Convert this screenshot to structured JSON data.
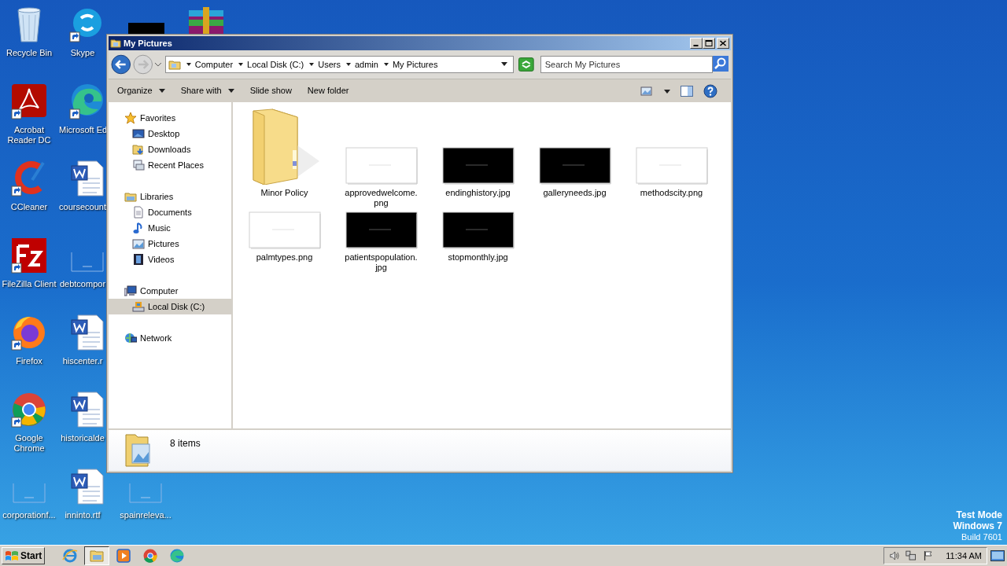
{
  "desktop": {
    "rows": [
      [
        {
          "label": "Recycle Bin",
          "kind": "recycle",
          "shortcut": false
        },
        {
          "label": "Skype",
          "kind": "skype",
          "shortcut": true
        }
      ],
      [
        {
          "label": "Acrobat Reader DC",
          "kind": "acrobat",
          "shortcut": true
        },
        {
          "label": "Microsoft Ed",
          "kind": "edge",
          "shortcut": true
        }
      ],
      [
        {
          "label": "CCleaner",
          "kind": "ccleaner",
          "shortcut": true
        },
        {
          "label": "coursecount",
          "kind": "word",
          "shortcut": false
        }
      ],
      [
        {
          "label": "FileZilla Client",
          "kind": "filezilla",
          "shortcut": true
        },
        {
          "label": "debtcompor",
          "kind": "blank",
          "shortcut": false
        }
      ],
      [
        {
          "label": "Firefox",
          "kind": "firefox",
          "shortcut": true
        },
        {
          "label": "hiscenter.r",
          "kind": "word",
          "shortcut": false
        }
      ],
      [
        {
          "label": "Google Chrome",
          "kind": "chrome",
          "shortcut": true
        },
        {
          "label": "historicalde",
          "kind": "word",
          "shortcut": false
        }
      ],
      [
        {
          "label": "corporationf...",
          "kind": "blank",
          "shortcut": false
        },
        {
          "label": "inninto.rtf",
          "kind": "word",
          "shortcut": false
        },
        {
          "label": "spainreleva...",
          "kind": "blank",
          "shortcut": false
        }
      ]
    ],
    "test_mode": [
      {
        "text": "Test Mode",
        "bold": true
      },
      {
        "text": "Windows 7",
        "bold": true
      },
      {
        "text": "Build 7601",
        "bold": false
      }
    ]
  },
  "window": {
    "title": "My Pictures",
    "back": {
      "disabled": false
    },
    "forward": {
      "disabled": true
    },
    "breadcrumb": [
      "Computer",
      "Local Disk (C:)",
      "Users",
      "admin",
      "My Pictures"
    ],
    "search": {
      "placeholder": "Search My Pictures"
    },
    "toolbar": [
      {
        "label": "Organize",
        "menu": true
      },
      {
        "label": "Share with",
        "menu": true
      },
      {
        "label": "Slide show",
        "menu": false
      },
      {
        "label": "New folder",
        "menu": false
      }
    ],
    "nav_pane": [
      {
        "label": "Favorites",
        "kind": "star",
        "selected": false,
        "children": [
          {
            "label": "Desktop",
            "kind": "desktop",
            "selected": false
          },
          {
            "label": "Downloads",
            "kind": "downloads",
            "selected": false
          },
          {
            "label": "Recent Places",
            "kind": "recent",
            "selected": false
          }
        ]
      },
      {
        "label": "Libraries",
        "kind": "library",
        "selected": false,
        "children": [
          {
            "label": "Documents",
            "kind": "documents",
            "selected": false
          },
          {
            "label": "Music",
            "kind": "music",
            "selected": false
          },
          {
            "label": "Pictures",
            "kind": "pictures",
            "selected": false
          },
          {
            "label": "Videos",
            "kind": "videos",
            "selected": false
          }
        ]
      },
      {
        "label": "Computer",
        "kind": "computer",
        "selected": false,
        "children": [
          {
            "label": "Local Disk (C:)",
            "kind": "disk",
            "selected": true
          }
        ]
      },
      {
        "label": "Network",
        "kind": "network",
        "selected": false
      }
    ],
    "items": [
      {
        "name": "Minor Policy",
        "kind": "folder"
      },
      {
        "name": "approvedwelcome.png",
        "dark": false
      },
      {
        "name": "endinghistory.jpg",
        "dark": true
      },
      {
        "name": "galleryneeds.jpg",
        "dark": true
      },
      {
        "name": "methodscity.png",
        "dark": false
      },
      {
        "name": "palmtypes.png",
        "dark": false
      },
      {
        "name": "patientspopulation.jpg",
        "dark": true
      },
      {
        "name": "stopmonthly.jpg",
        "dark": true
      }
    ],
    "status": "8 items"
  },
  "taskbar": {
    "start": "Start",
    "apps": [
      {
        "kind": "ie",
        "active": false
      },
      {
        "kind": "explorer",
        "active": true
      },
      {
        "kind": "media",
        "active": false
      },
      {
        "kind": "chrome",
        "active": false
      },
      {
        "kind": "edge",
        "active": false
      }
    ],
    "clock": "11:34 AM"
  }
}
